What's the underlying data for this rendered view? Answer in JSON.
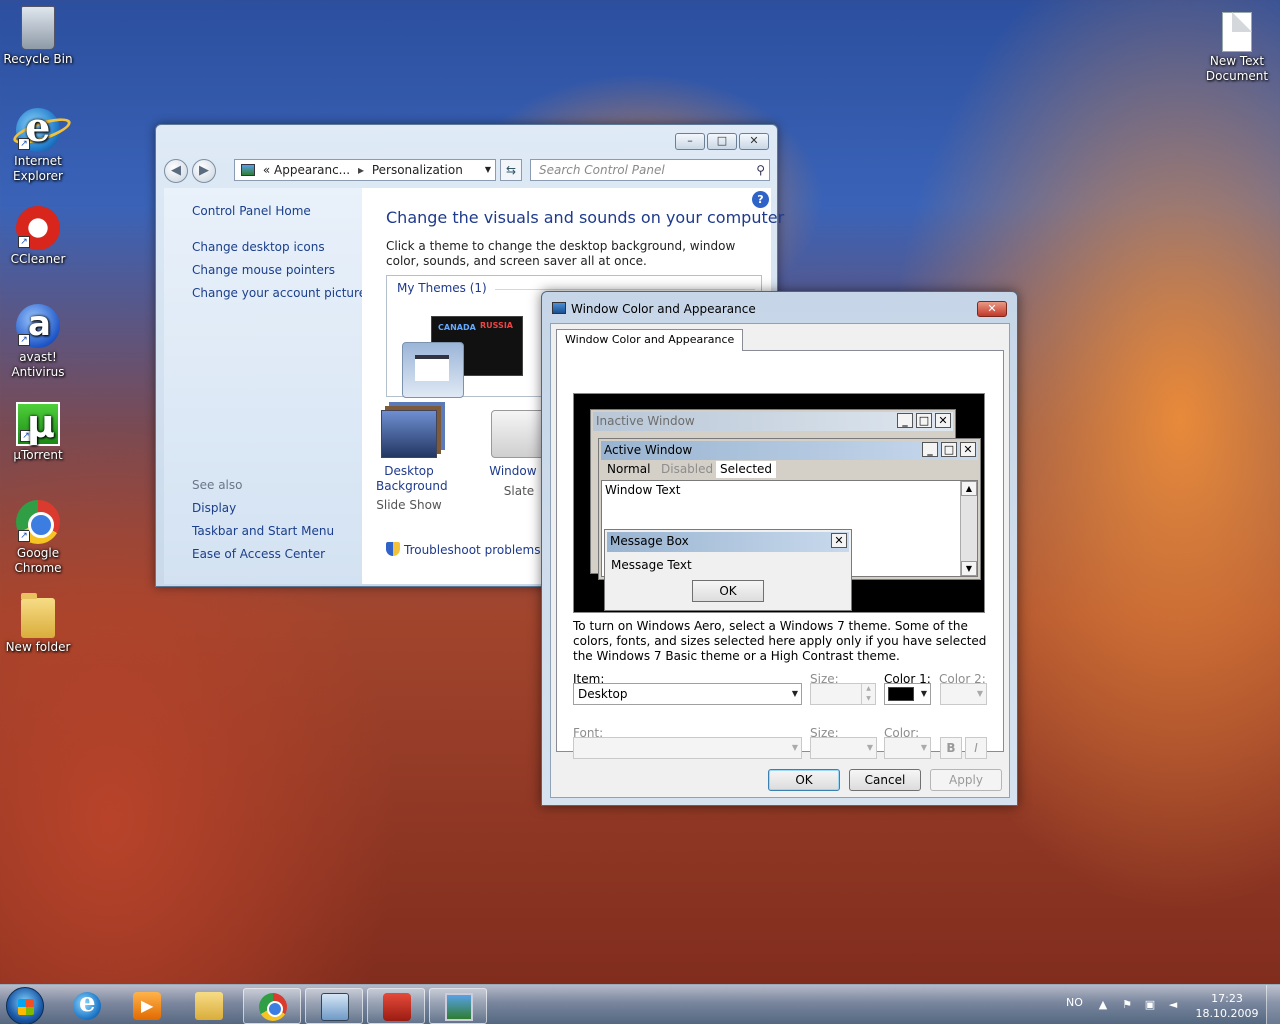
{
  "desktop": {
    "icons": [
      {
        "label": "Recycle Bin",
        "icon": "recycle-bin-icon"
      },
      {
        "label": "Internet\nExplorer",
        "icon": "internet-explorer-icon"
      },
      {
        "label": "CCleaner",
        "icon": "ccleaner-icon"
      },
      {
        "label": "avast!\nAntivirus",
        "icon": "avast-icon"
      },
      {
        "label": "µTorrent",
        "icon": "utorrent-icon"
      },
      {
        "label": "Google\nChrome",
        "icon": "chrome-icon"
      },
      {
        "label": "New folder",
        "icon": "folder-icon"
      },
      {
        "label": "New Text\nDocument",
        "icon": "text-document-icon"
      }
    ]
  },
  "personalization": {
    "caption_buttons": {
      "minimize": "–",
      "maximize": "□",
      "close": "✕"
    },
    "address": {
      "part1": "Appearanc...",
      "part2": "Personalization",
      "prefix": "«",
      "separator": "▸"
    },
    "search_placeholder": "Search Control Panel",
    "left_nav": {
      "home": "Control Panel Home",
      "links": [
        "Change desktop icons",
        "Change mouse pointers",
        "Change your account picture"
      ],
      "see_also_title": "See also",
      "see_also": [
        "Display",
        "Taskbar and Start Menu",
        "Ease of Access Center"
      ]
    },
    "heading": "Change the visuals and sounds on your computer",
    "description": "Click a theme to change the desktop background, window color, sounds, and screen saver all at once.",
    "my_themes": "My Themes (1)",
    "theme_thumb_text": [
      "CANADA",
      "RUSSIA"
    ],
    "tiles": [
      {
        "title": "Desktop\nBackground",
        "sub": "Slide Show"
      },
      {
        "title": "Window C",
        "sub": "Slate"
      }
    ],
    "troubleshoot": "Troubleshoot problems w",
    "help": "?"
  },
  "dialog": {
    "title": "Window Color and Appearance",
    "tab": "Window Color and Appearance",
    "preview": {
      "inactive_title": "Inactive Window",
      "active_title": "Active Window",
      "menu": {
        "normal": "Normal",
        "disabled": "Disabled",
        "selected": "Selected"
      },
      "window_text": "Window Text",
      "msgbox_title": "Message Box",
      "msgbox_text": "Message Text",
      "msgbox_ok": "OK"
    },
    "info": "To turn on Windows Aero, select a Windows 7 theme.  Some of the colors, fonts, and sizes selected here apply only if you have selected the Windows 7 Basic theme or a High Contrast theme.",
    "item_label": "Item:",
    "item_value": "Desktop",
    "size_label": "Size:",
    "color1_label": "Color 1:",
    "color2_label": "Color 2:",
    "color1_value": "#000000",
    "font_label": "Font:",
    "font_size_label": "Size:",
    "font_color_label": "Color:",
    "bold": "B",
    "italic": "I",
    "buttons": {
      "ok": "OK",
      "cancel": "Cancel",
      "apply": "Apply"
    }
  },
  "taskbar": {
    "apps": [
      {
        "icon": "internet-explorer-icon",
        "active": false
      },
      {
        "icon": "media-player-icon",
        "active": false
      },
      {
        "icon": "windows-explorer-icon",
        "active": false
      },
      {
        "icon": "chrome-icon",
        "active": true
      },
      {
        "icon": "control-panel-icon",
        "active": true
      },
      {
        "icon": "toolbox-icon",
        "active": true
      },
      {
        "icon": "personalization-icon",
        "active": true
      }
    ],
    "language": "NO",
    "time": "17:23",
    "date": "18.10.2009"
  }
}
